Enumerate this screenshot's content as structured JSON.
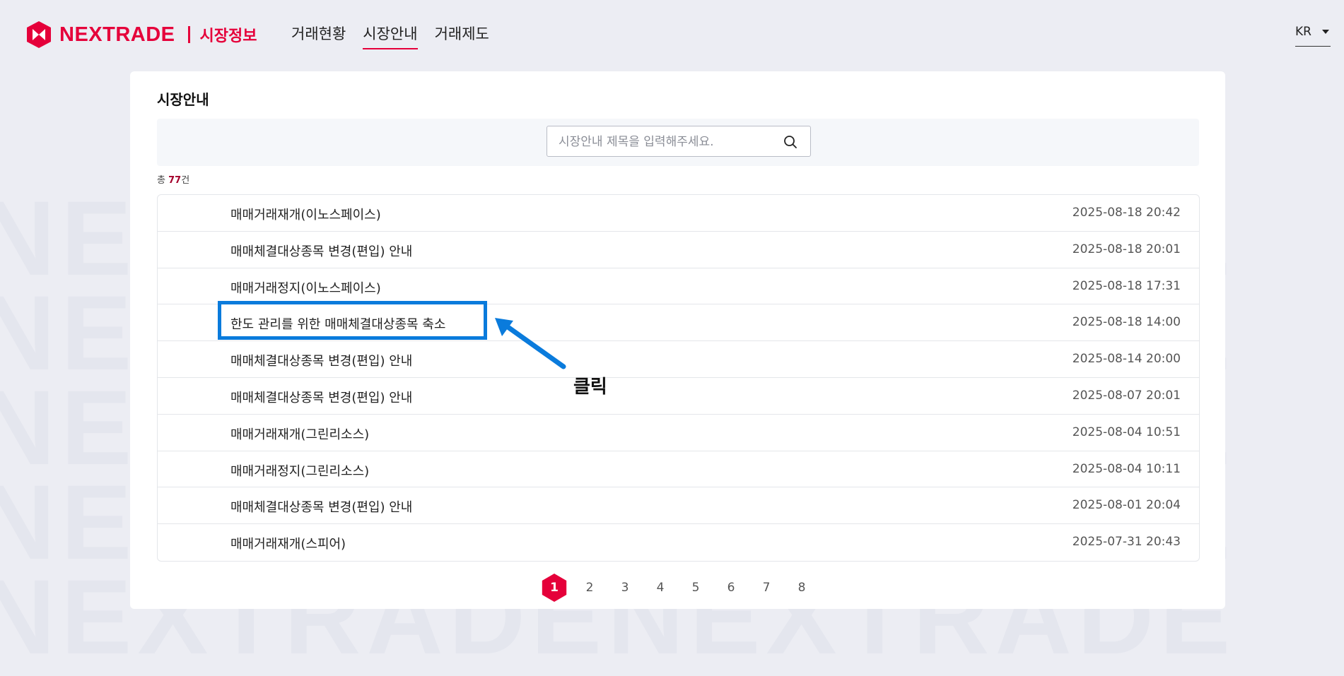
{
  "colors": {
    "brand": "#e5003a",
    "highlight": "#0a7bdc",
    "background": "#ecedf3"
  },
  "watermark": {
    "text": "NEXTRADENEXTRADE"
  },
  "header": {
    "logo_text": "NEXTRADE",
    "logo_sub": "시장정보",
    "nav": [
      {
        "label": "거래현황",
        "active": false
      },
      {
        "label": "시장안내",
        "active": true
      },
      {
        "label": "거래제도",
        "active": false
      }
    ],
    "language": "KR"
  },
  "main": {
    "title": "시장안내",
    "search": {
      "placeholder": "시장안내 제목을 입력해주세요.",
      "value": "",
      "icon": "search-icon"
    },
    "total": {
      "prefix": "총",
      "count": "77",
      "suffix": "건"
    },
    "notices": [
      {
        "title": "매매거래재개(이노스페이스)",
        "date": "2025-08-18 20:42"
      },
      {
        "title": "매매체결대상종목 변경(편입) 안내",
        "date": "2025-08-18 20:01"
      },
      {
        "title": "매매거래정지(이노스페이스)",
        "date": "2025-08-18 17:31"
      },
      {
        "title": "한도 관리를 위한 매매체결대상종목 축소",
        "date": "2025-08-18 14:00"
      },
      {
        "title": "매매체결대상종목 변경(편입) 안내",
        "date": "2025-08-14 20:00"
      },
      {
        "title": "매매체결대상종목 변경(편입) 안내",
        "date": "2025-08-07 20:01"
      },
      {
        "title": "매매거래재개(그린리소스)",
        "date": "2025-08-04 10:51"
      },
      {
        "title": "매매거래정지(그린리소스)",
        "date": "2025-08-04 10:11"
      },
      {
        "title": "매매체결대상종목 변경(편입) 안내",
        "date": "2025-08-01 20:04"
      },
      {
        "title": "매매거래재개(스피어)",
        "date": "2025-07-31 20:43"
      }
    ],
    "pagination": {
      "pages": [
        "1",
        "2",
        "3",
        "4",
        "5",
        "6",
        "7",
        "8"
      ],
      "current": "1"
    }
  },
  "annotation": {
    "label": "클릭",
    "target": "한도 관리를 위한 매매체결대상종목 축소"
  }
}
